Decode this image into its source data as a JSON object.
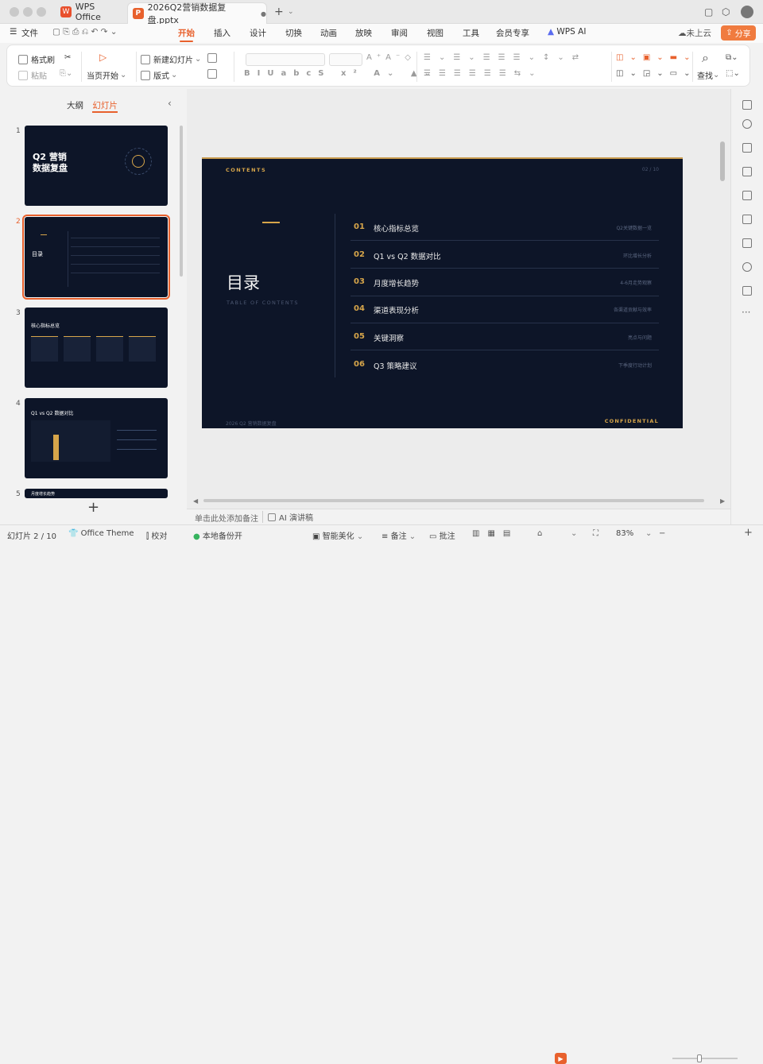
{
  "titlebar": {
    "tabs": [
      {
        "label": "WPS Office",
        "logo": "W"
      },
      {
        "label": "2026Q2营销数据复盘.pptx",
        "logo": "P"
      }
    ],
    "new_tab_icon": "plus-icon"
  },
  "menu": {
    "file": "文件",
    "items": [
      "开始",
      "插入",
      "设计",
      "切换",
      "动画",
      "放映",
      "审阅",
      "视图",
      "工具",
      "会员专享",
      "WPS AI"
    ],
    "active": "开始",
    "cloud": "未上云",
    "share": "分享"
  },
  "ribbon": {
    "format_painter": "格式刷",
    "paste": "粘贴",
    "start_from_current": "当页开始",
    "new_slide": "新建幻灯片",
    "layout": "版式",
    "find": "查找"
  },
  "left_panel": {
    "tab_outline": "大纲",
    "tab_slides": "幻灯片",
    "active_tab": "幻灯片",
    "thumbnails": [
      {
        "num": "1",
        "title1": "Q2 营销",
        "title2": "数据复盘"
      },
      {
        "num": "2",
        "title1": "目录"
      },
      {
        "num": "3",
        "title1": "核心指标总览"
      },
      {
        "num": "4",
        "title1": "Q1 vs Q2 数据对比"
      },
      {
        "num": "5",
        "title1": "月度增长趋势"
      }
    ],
    "selected": "2"
  },
  "slide": {
    "header_label": "CONTENTS",
    "page": "02 / 10",
    "title": "目录",
    "subtitle": "TABLE OF CONTENTS",
    "items": [
      {
        "num": "01",
        "title": "核心指标总览",
        "sub": "Q2关键数据一览"
      },
      {
        "num": "02",
        "title": "Q1 vs Q2 数据对比",
        "sub": "环比增长分析"
      },
      {
        "num": "03",
        "title": "月度增长趋势",
        "sub": "4-6月走势观察"
      },
      {
        "num": "04",
        "title": "渠道表现分析",
        "sub": "各渠道贡献与效率"
      },
      {
        "num": "05",
        "title": "关键洞察",
        "sub": "亮点与问题"
      },
      {
        "num": "06",
        "title": "Q3 策略建议",
        "sub": "下季度行动计划"
      }
    ],
    "footer_left": "2026 Q2 营销数据复盘",
    "footer_right": "CONFIDENTIAL"
  },
  "notes": {
    "placeholder": "单击此处添加备注",
    "ai_script": "AI 演讲稿"
  },
  "status": {
    "slide_counter": "幻灯片 2 / 10",
    "theme": "Office Theme",
    "proofread": "校对",
    "local_backup": "本地备份开",
    "smart_beautify": "智能美化",
    "notes": "备注",
    "comments": "批注",
    "zoom": "83%"
  },
  "colors": {
    "accent": "#e8612d",
    "slide_bg": "#0d1528",
    "gold": "#d6a54a"
  }
}
